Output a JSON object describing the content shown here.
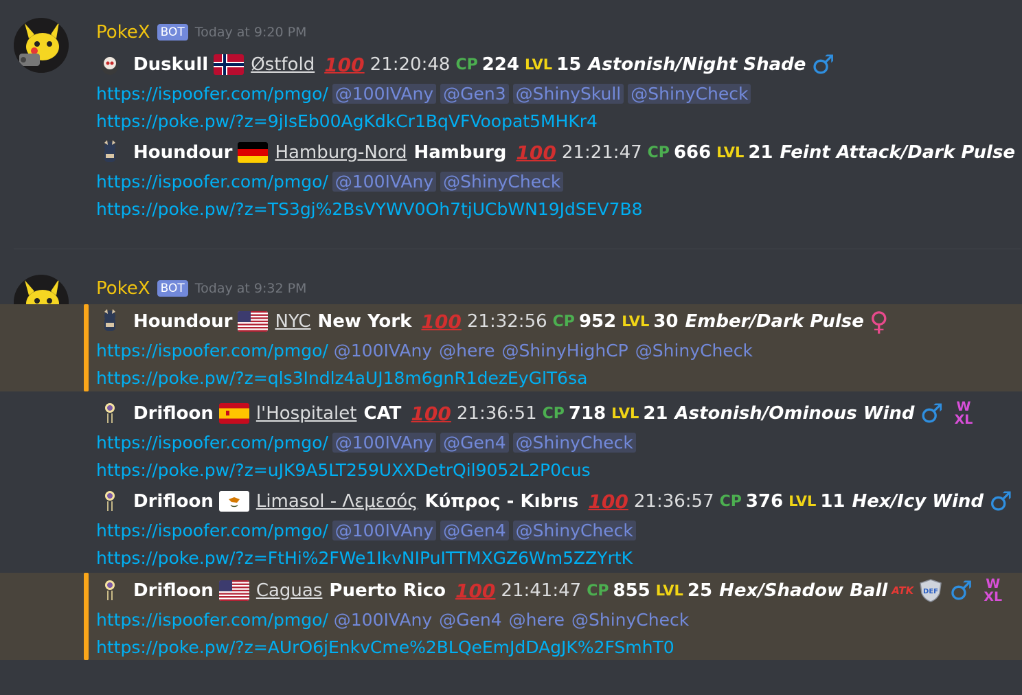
{
  "messages": [
    {
      "author": "PokeX",
      "bot_tag": "BOT",
      "timestamp": "Today at 9:20 PM",
      "entries": [
        {
          "pokemon": "Duskull",
          "flag": "norway-flag",
          "city": "Østfold",
          "region": "",
          "iv_icon": "100",
          "time": "21:20:48",
          "cp_icon": "CP",
          "cp": "224",
          "lvl_icon": "LVL",
          "lvl": "15",
          "moves": "Astonish/Night Shade",
          "gender": "♂",
          "link1": "https://ispoofer.com/pmgo/",
          "mentions": [
            "@100IVAny",
            "@Gen3",
            "@ShinySkull",
            "@ShinyCheck"
          ],
          "link2": "https://poke.pw/?z=9jIsEb00AgKdkCr1BqVFVoopat5MHKr4"
        },
        {
          "pokemon": "Houndour",
          "flag": "germany-flag",
          "city": "Hamburg-Nord",
          "region": "Hamburg",
          "iv_icon": "100",
          "time": "21:21:47",
          "cp_icon": "CP",
          "cp": "666",
          "lvl_icon": "LVL",
          "lvl": "21",
          "moves": "Feint Attack/Dark Pulse",
          "gender": "♀",
          "link1": "https://ispoofer.com/pmgo/",
          "mentions": [
            "@100IVAny",
            "@ShinyCheck"
          ],
          "link2": "https://poke.pw/?z=TS3gj%2BsVYWV0Oh7tjUCbWN19JdSEV7B8"
        }
      ]
    },
    {
      "author": "PokeX",
      "bot_tag": "BOT",
      "timestamp": "Today at 9:32 PM",
      "entries": [
        {
          "pokemon": "Houndour",
          "flag": "usa-flag",
          "city": "NYC",
          "region": "New York",
          "iv_icon": "100",
          "time": "21:32:56",
          "cp_icon": "CP",
          "cp": "952",
          "lvl_icon": "LVL",
          "lvl": "30",
          "moves": "Ember/Dark Pulse",
          "gender": "♀",
          "link1": "https://ispoofer.com/pmgo/",
          "mentions": [
            "@100IVAny",
            "@here",
            "@ShinyHighCP",
            "@ShinyCheck"
          ],
          "link2": "https://poke.pw/?z=qls3Indlz4aUJ18m6gnR1dezEyGlT6sa"
        },
        {
          "pokemon": "Drifloon",
          "flag": "spain-flag",
          "city": "l'Hospitalet",
          "region": "CAT",
          "iv_icon": "100",
          "time": "21:36:51",
          "cp_icon": "CP",
          "cp": "718",
          "lvl_icon": "LVL",
          "lvl": "21",
          "moves": "Astonish/Ominous Wind",
          "gender": "♂",
          "badge_w": "W",
          "badge_xl": "XL",
          "link1": "https://ispoofer.com/pmgo/",
          "mentions": [
            "@100IVAny",
            "@Gen4",
            "@ShinyCheck"
          ],
          "link2": "https://poke.pw/?z=uJK9A5LT259UXXDetrQil9052L2P0cus"
        },
        {
          "pokemon": "Drifloon",
          "flag": "cyprus-flag",
          "city": "Limasol - Λεμεσός",
          "region": "Κύπρος - Kıbrıs",
          "iv_icon": "100",
          "time": "21:36:57",
          "cp_icon": "CP",
          "cp": "376",
          "lvl_icon": "LVL",
          "lvl": "11",
          "moves": "Hex/Icy Wind",
          "gender": "♂",
          "badge_w": "W",
          "badge_xl": "XL",
          "link1": "https://ispoofer.com/pmgo/",
          "mentions": [
            "@100IVAny",
            "@Gen4",
            "@ShinyCheck"
          ],
          "link2": "https://poke.pw/?z=FtHi%2FWe1IkvNIPuITTMXGZ6Wm5ZZYrtK"
        },
        {
          "pokemon": "Drifloon",
          "flag": "puerto-rico-flag",
          "city": "Caguas",
          "region": "Puerto Rico",
          "iv_icon": "100",
          "time": "21:41:47",
          "cp_icon": "CP",
          "cp": "855",
          "lvl_icon": "LVL",
          "lvl": "25",
          "moves": "Hex/Shadow Ball",
          "atk_icon": "ATK",
          "def_icon": "DEF",
          "gender": "♂",
          "badge_w": "W",
          "badge_xl": "XL",
          "link1": "https://ispoofer.com/pmgo/",
          "mentions": [
            "@100IVAny",
            "@Gen4",
            "@here",
            "@ShinyCheck"
          ],
          "link2": "https://poke.pw/?z=AUrO6jEnkvCme%2BLQeEmJdDAgJK%2FSmhT0"
        }
      ]
    }
  ],
  "colors": {
    "background": "#36393f",
    "username": "#f1c40f",
    "link": "#00b0f4",
    "mention": "#7289da",
    "highlight_bg": "#49443c",
    "highlight_bar": "#faa61a"
  }
}
